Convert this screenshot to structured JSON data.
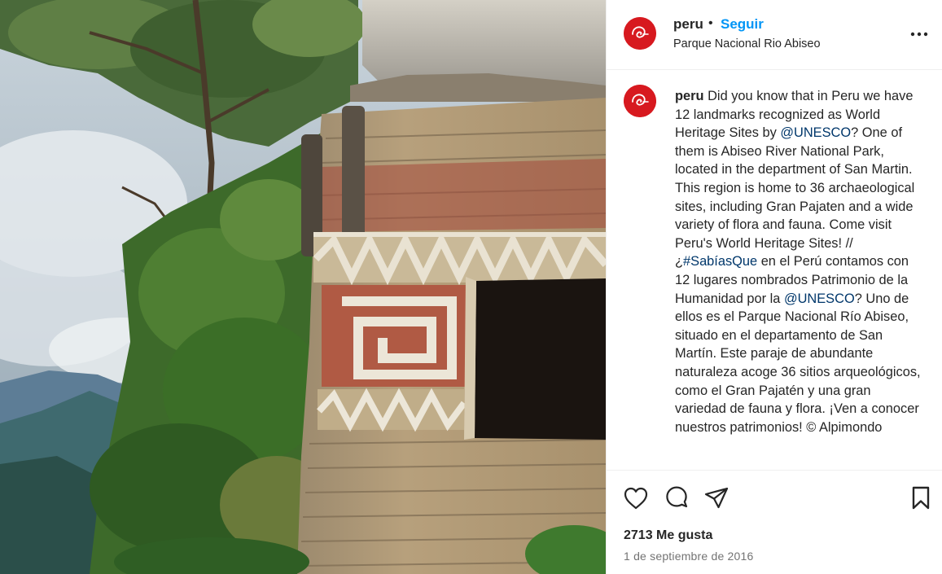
{
  "post": {
    "image_alt": "Pre-Inca circular stone building with red and white zigzag friezes in Parque Nacional Rio Abiseo"
  },
  "header": {
    "username": "peru",
    "separator": "•",
    "follow_label": "Seguir",
    "location": "Parque Nacional Rio Abiseo",
    "more_icon": "more-horizontal-icon"
  },
  "caption": {
    "username": "peru",
    "parts": [
      {
        "text": " Did you know that in Peru we have 12 landmarks recognized as World Heritage Sites by ",
        "link": false
      },
      {
        "text": "@UNESCO",
        "link": true
      },
      {
        "text": "? One of them is Abiseo River National Park, located in the department of San Martin. This region is home to 36 archaeological sites, including Gran Pajaten and a wide variety of flora and fauna. Come visit Peru's World Heritage Sites! // ¿",
        "link": false
      },
      {
        "text": "#SabíasQue",
        "link": true
      },
      {
        "text": " en el Perú contamos con 12 lugares nombrados Patrimonio de la Humanidad por la ",
        "link": false
      },
      {
        "text": "@UNESCO",
        "link": true
      },
      {
        "text": "? Uno de ellos es el Parque Nacional Río Abiseo, situado en el departamento de San Martín. Este paraje de abundante naturaleza acoge 36 sitios arqueológicos, como el Gran Pajatén y una gran variedad de fauna y flora. ¡Ven a conocer nuestros patrimonios! © Alpimondo",
        "link": false
      }
    ]
  },
  "actions": {
    "icons": [
      "heart-icon",
      "comment-icon",
      "share-icon",
      "bookmark-icon"
    ],
    "likes": "2713 Me gusta",
    "date": "1 de septiembre de 2016"
  },
  "colors": {
    "follow": "#0095f6",
    "link": "#00376b",
    "brand_red": "#d7191f",
    "muted": "#737373"
  }
}
